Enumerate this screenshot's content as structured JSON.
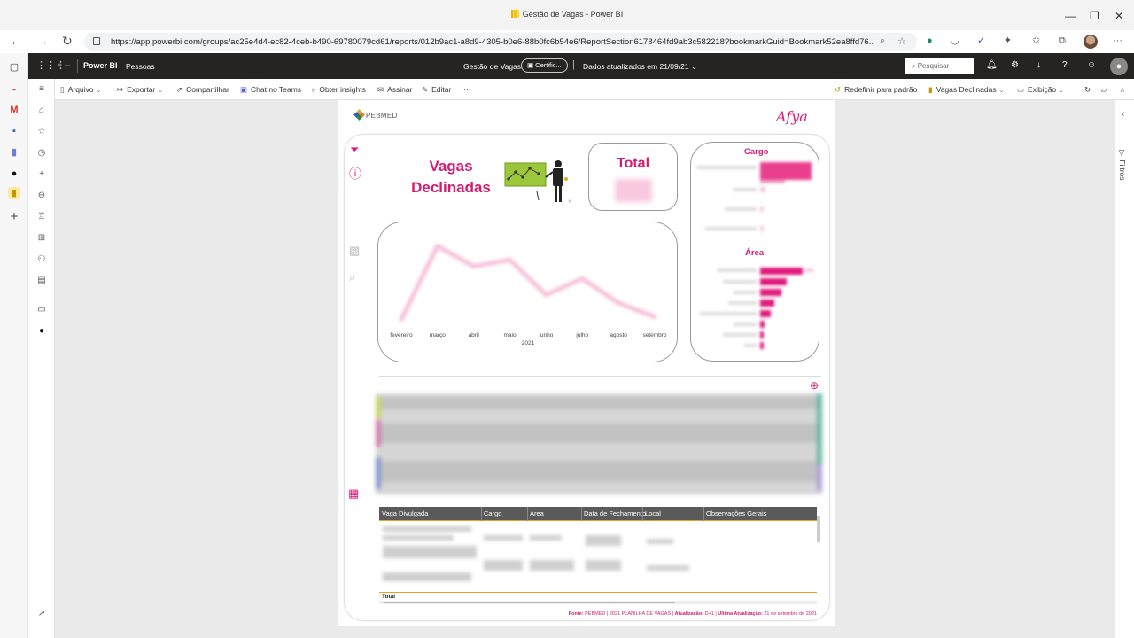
{
  "browser": {
    "window_title": "Gestão de Vagas - Power BI",
    "url": "https://app.powerbi.com/groups/ac25e4d4-ec82-4ceb-b490-69780079cd61/reports/012b9ac1-a8d9-4305-b0e6-88b0fc6b54e6/ReportSection6178464fd9ab3c582218?bookmarkGuid=Bookmark52ea8ffd76..."
  },
  "pbi_header": {
    "brand": "Power BI",
    "workspace": "Pessoas",
    "report_title": "Gestão de Vagas",
    "certified": "Certific...",
    "updated": "Dados atualizados em 21/09/21",
    "search_placeholder": "Pesquisar"
  },
  "commands": {
    "arquivo": "Arquivo",
    "exportar": "Exportar",
    "compartilhar": "Compartilhar",
    "chat": "Chat no Teams",
    "insights": "Obter insights",
    "assinar": "Assinar",
    "editar": "Editar",
    "more": "···",
    "redefinir": "Redefinir para padrão",
    "bookmark": "Vagas Declinadas",
    "exibicao": "Exibição"
  },
  "right_pane": {
    "filters": "Filtros"
  },
  "report": {
    "logo_left": "PEBMED",
    "logo_right": "Afya",
    "title_line1": "Vagas",
    "title_line2": "Declinadas",
    "total_label": "Total",
    "cargo_label": "Cargo",
    "area_label": "Área",
    "footer": {
      "fonte_label": "Fonte:",
      "fonte_text": "PEBMED | 2021 PLANILHA DE VAGAS |",
      "atualizacao_label": "Atualização:",
      "atualizacao_text": "D+1 |",
      "ultima_label": "Última Atualização:",
      "ultima_text": "21 de setembro de 2021"
    },
    "table": {
      "columns": [
        "Vaga Divulgada",
        "Cargo",
        "Área",
        "Data de Fechamento",
        "Local",
        "Observações Gerais"
      ],
      "total_label": "Total"
    }
  },
  "chart_data": {
    "type": "line",
    "categories": [
      "fevereiro",
      "março",
      "abril",
      "maio",
      "junho",
      "julho",
      "agosto",
      "setembro"
    ],
    "xlabel": "2021",
    "values": [
      5,
      95,
      70,
      78,
      35,
      55,
      25,
      8
    ],
    "ylim": [
      0,
      100
    ],
    "color": "#f7c0d9"
  },
  "colors": {
    "accent": "#d41b71",
    "header": "#252423"
  }
}
